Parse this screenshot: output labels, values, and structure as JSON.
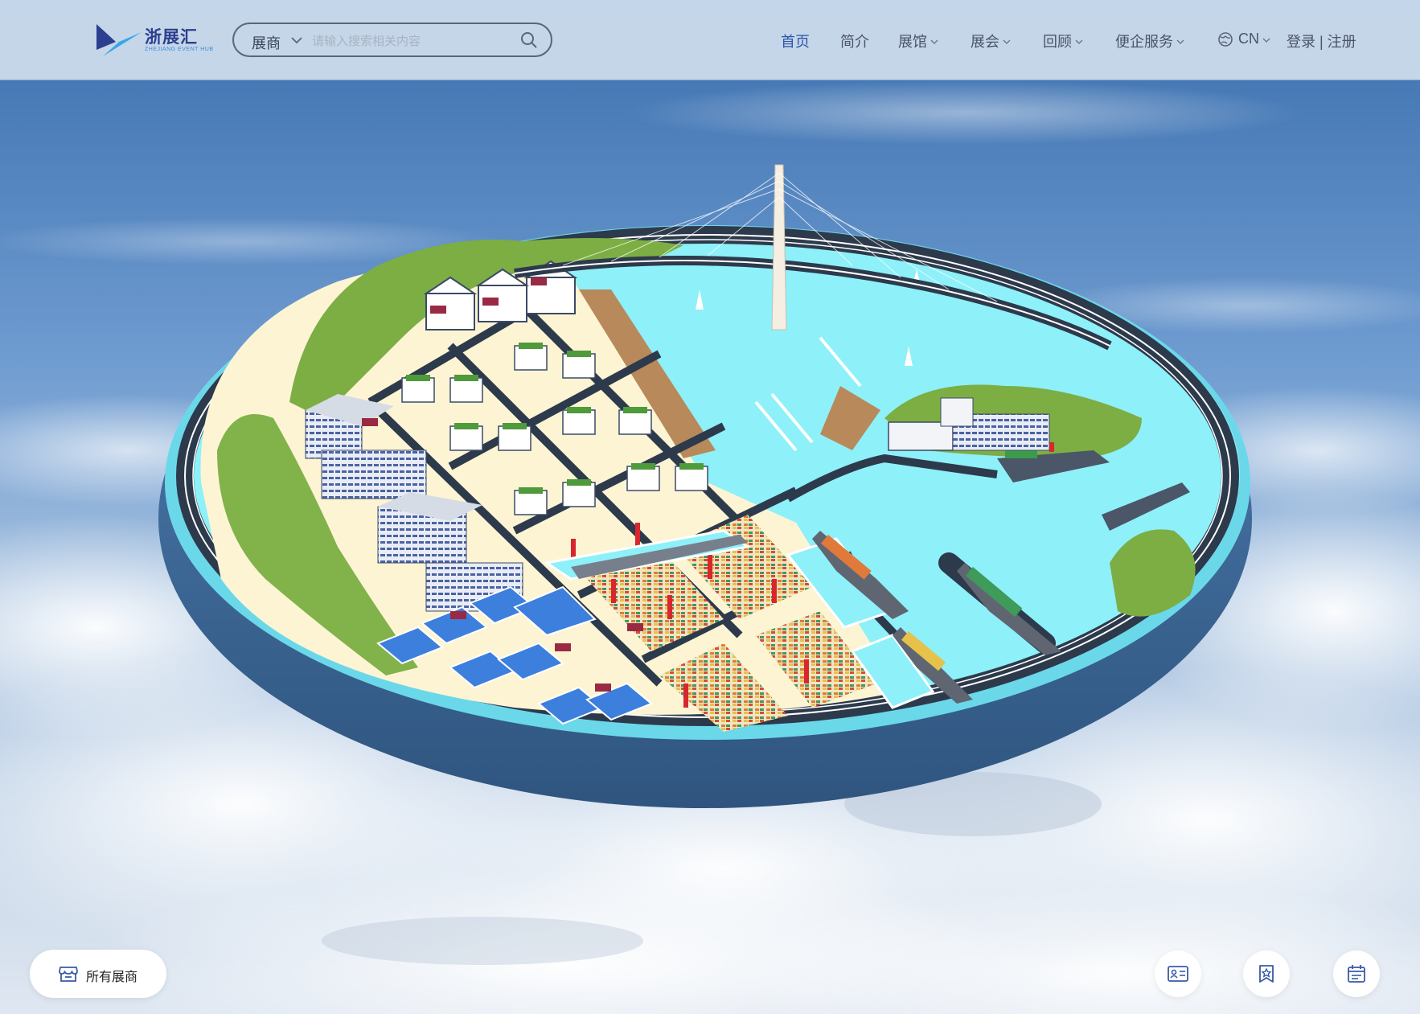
{
  "logo": {
    "name": "浙展汇",
    "subtitle": "ZHEJIANG EVENT HUB"
  },
  "search": {
    "category": "展商",
    "placeholder": "请输入搜索相关内容"
  },
  "nav": [
    {
      "label": "首页",
      "active": true,
      "has_dropdown": false
    },
    {
      "label": "简介",
      "active": false,
      "has_dropdown": false
    },
    {
      "label": "展馆",
      "active": false,
      "has_dropdown": true
    },
    {
      "label": "展会",
      "active": false,
      "has_dropdown": true
    },
    {
      "label": "回顾",
      "active": false,
      "has_dropdown": true
    },
    {
      "label": "便企服务",
      "active": false,
      "has_dropdown": true
    }
  ],
  "language": {
    "label": "CN",
    "icon": "globe-icon"
  },
  "auth": {
    "label": "登录 | 注册"
  },
  "floating": {
    "all_exhibitors": {
      "label": "所有展商",
      "icon": "store-icon"
    },
    "buttons": [
      {
        "icon": "business-card-icon"
      },
      {
        "icon": "star-favorite-icon"
      },
      {
        "icon": "calendar-icon"
      }
    ]
  },
  "colors": {
    "accent": "#2d55a8",
    "header_bg": "#d0deee",
    "water": "#8eecf6",
    "island_rim": "#3e6a9b"
  }
}
